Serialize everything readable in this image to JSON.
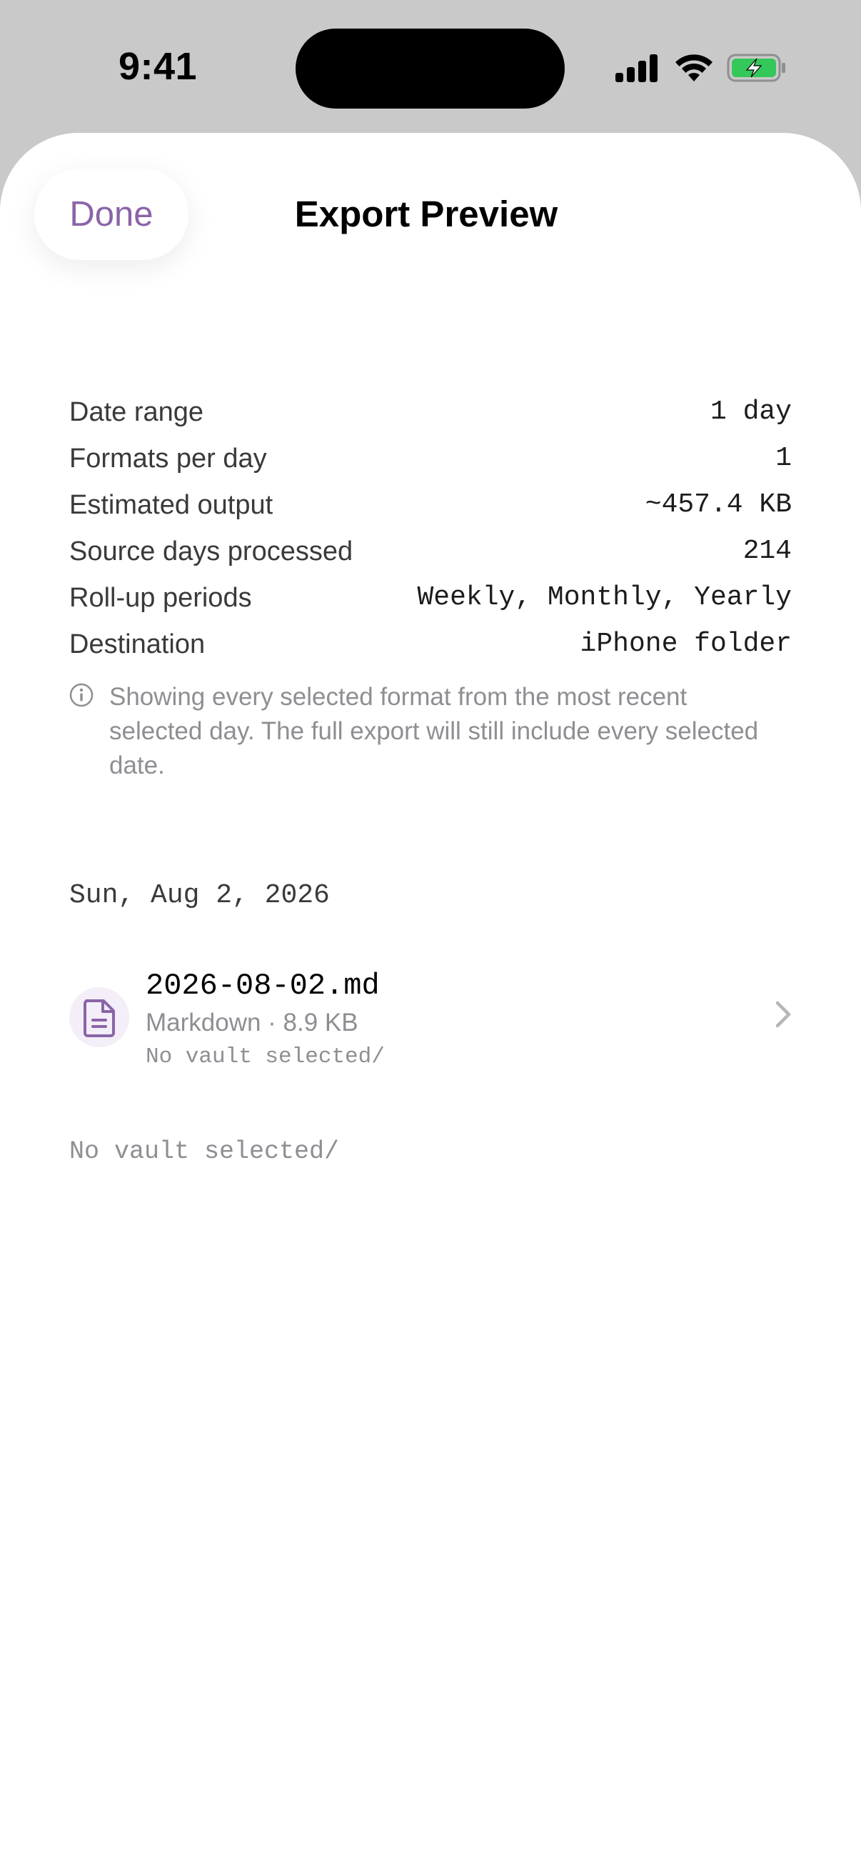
{
  "status_bar": {
    "time": "9:41"
  },
  "header": {
    "done_label": "Done",
    "title": "Export Preview"
  },
  "summary": {
    "rows": [
      {
        "label": "Date range",
        "value": "1 day"
      },
      {
        "label": "Formats per day",
        "value": "1"
      },
      {
        "label": "Estimated output",
        "value": "~457.4 KB"
      },
      {
        "label": "Source days processed",
        "value": "214"
      },
      {
        "label": "Roll-up periods",
        "value": "Weekly, Monthly, Yearly"
      },
      {
        "label": "Destination",
        "value": "iPhone folder"
      }
    ],
    "note": "Showing every selected format from the most recent selected day. The full export will still include every selected date."
  },
  "section": {
    "date": "Sun, Aug 2, 2026",
    "file": {
      "name": "2026-08-02.md",
      "meta": "Markdown · 8.9 KB",
      "path": "No vault selected/"
    },
    "footer_path": "No vault selected/"
  },
  "colors": {
    "accent": "#8a64a8",
    "battery": "#34c759",
    "secondary_text": "#8e8e93"
  },
  "icons": {
    "signal": "cellular-signal-icon",
    "wifi": "wifi-icon",
    "battery": "battery-charging-icon",
    "info": "info-circle-icon",
    "file": "document-icon",
    "chevron": "chevron-right-icon"
  }
}
